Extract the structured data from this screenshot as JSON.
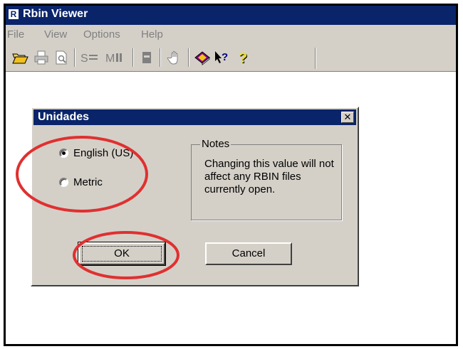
{
  "window": {
    "app_icon_letter": "R",
    "title": "Rbin Viewer"
  },
  "menu": [
    "File",
    "View",
    "Options",
    "Help"
  ],
  "toolbar": {
    "buttons": [
      "open-folder-icon",
      "print-icon",
      "print-preview-icon",
      "s-list-icon",
      "m-list-icon",
      "page-icon",
      "hand-icon",
      "book-icon",
      "context-help-icon",
      "help-icon"
    ]
  },
  "dialog": {
    "title": "Unidades",
    "close_glyph": "✕",
    "units": {
      "selected": "English (US)",
      "options": [
        "English (US)",
        "Metric"
      ]
    },
    "notes": {
      "title": "Notes",
      "text": "Changing this value will not affect any RBIN files currently open."
    },
    "ok_label": "OK",
    "cancel_label": "Cancel"
  },
  "annotation_color": "#e03030"
}
